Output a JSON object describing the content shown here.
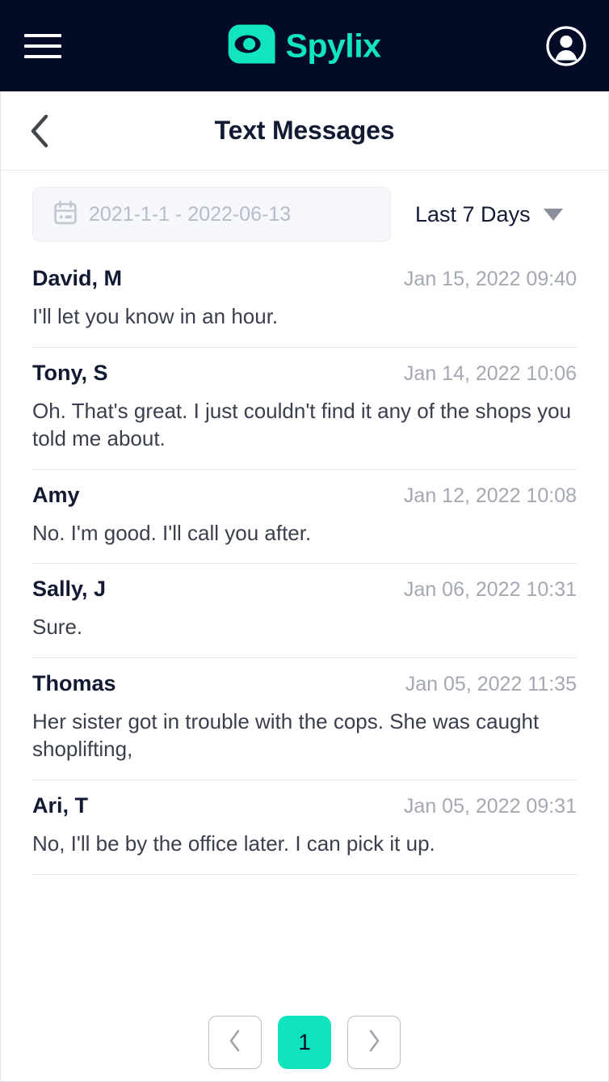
{
  "topbar": {
    "menu_label": "Menu",
    "brand_name": "Spylix",
    "account_label": "Account",
    "bg_color": "#030b26",
    "accent_color": "#10e5c0"
  },
  "titlebar": {
    "back_label": "Back",
    "title": "Text Messages"
  },
  "filters": {
    "date_range_value": "2021-1-1 - 2022-06-13",
    "date_range_placeholder": "2021-1-1 - 2022-06-13",
    "preset_label": "Last 7 Days"
  },
  "messages": [
    {
      "name": "David, M",
      "time": "Jan 15, 2022 09:40",
      "text": "I'll let you know in an hour."
    },
    {
      "name": "Tony, S",
      "time": "Jan 14, 2022 10:06",
      "text": "Oh. That's great. I just couldn't find it any of the shops you told me about."
    },
    {
      "name": "Amy",
      "time": "Jan 12, 2022 10:08",
      "text": "No. I'm good. I'll call you after."
    },
    {
      "name": "Sally, J",
      "time": "Jan 06, 2022 10:31",
      "text": "Sure."
    },
    {
      "name": "Thomas",
      "time": "Jan 05, 2022 11:35",
      "text": "Her sister got in trouble with the cops. She was caught shoplifting,"
    },
    {
      "name": "Ari, T",
      "time": "Jan 05, 2022 09:31",
      "text": "No, I'll be by the office later. I can pick it up."
    }
  ],
  "pagination": {
    "prev_label": "Previous page",
    "next_label": "Next page",
    "current_page": "1",
    "active_color": "#0fe3bd"
  }
}
